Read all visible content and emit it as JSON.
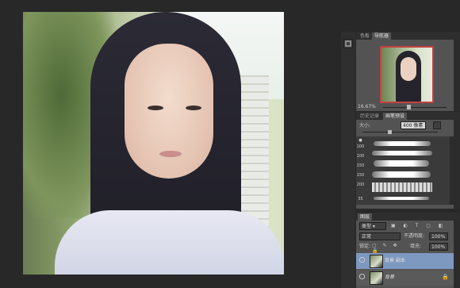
{
  "navigator": {
    "tabs": [
      "色板",
      "导航器"
    ],
    "zoom": "16.67%"
  },
  "brush": {
    "tabs": [
      "历史记录",
      "画笔预设"
    ],
    "size_label": "大小:",
    "size_value": "400 像素",
    "preset_sizes": [
      "100",
      "100",
      "150",
      "150",
      "200",
      "",
      "35"
    ]
  },
  "layers": {
    "tab": "图层",
    "filter_kind": "类型",
    "blend_mode": "正常",
    "opacity_label": "不透明度:",
    "opacity_value": "100%",
    "lock_label": "锁定:",
    "fill_label": "填充:",
    "fill_value": "100%",
    "items": [
      {
        "name": "背景 副本",
        "selected": true
      },
      {
        "name": "背景",
        "selected": false
      }
    ]
  },
  "colors": {
    "selection": "#7e99bf",
    "accent_red": "#c44141"
  }
}
